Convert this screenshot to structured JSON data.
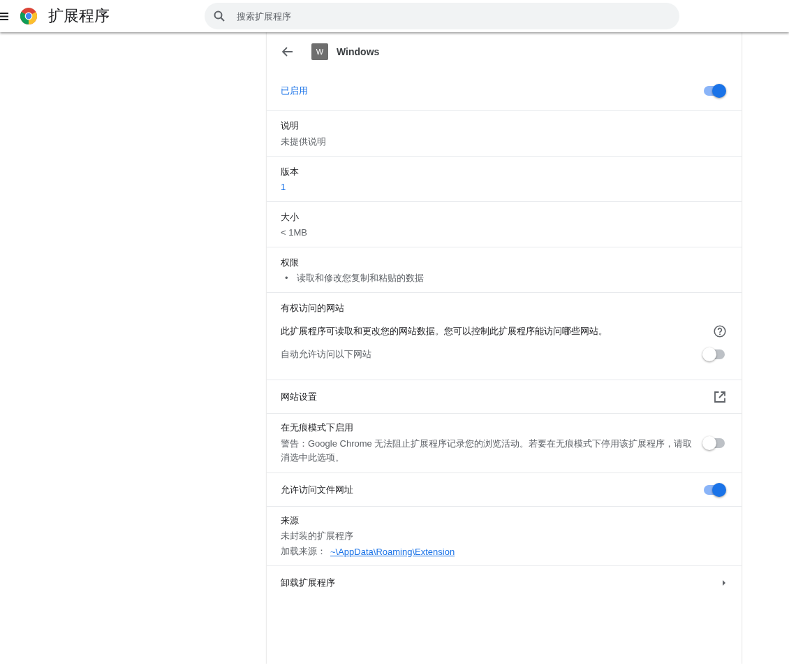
{
  "toolbar": {
    "title": "扩展程序",
    "search": {
      "placeholder": "搜索扩展程序"
    }
  },
  "extension": {
    "icon_letter": "W",
    "name": "Windows"
  },
  "rows": [
    {
      "kind": "toggle",
      "label": "已启用",
      "on": true
    },
    {
      "kind": "info",
      "title": "说明",
      "value": "未提供说明"
    },
    {
      "kind": "info-link",
      "title": "版本",
      "value": "1"
    },
    {
      "kind": "info",
      "title": "大小",
      "value": "< 1MB"
    },
    {
      "kind": "list",
      "title": "权限",
      "items": [
        {
          "bullet": "•",
          "text": "读取和修改您复制和粘贴的数据"
        }
      ]
    },
    {
      "kind": "site-access",
      "title": "有权访问的网站",
      "description": "此扩展程序可读取和更改您的网站数据。您可以控制此扩展程序能访问哪些网站。",
      "option": "自动允许访问以下网站",
      "on": false
    },
    {
      "kind": "external",
      "label": "网站设置"
    },
    {
      "kind": "toggle-desc",
      "title": "在无痕模式下启用",
      "description": "警告：Google Chrome 无法阻止扩展程序记录您的浏览活动。若要在无痕模式下停用该扩展程序，请取消选中此选项。",
      "on": false
    },
    {
      "kind": "plain-toggle",
      "label": "允许访问文件网址",
      "on": true
    },
    {
      "kind": "source",
      "title": "来源",
      "value": "未封装的扩展程序",
      "load_label": "加载来源：",
      "path": "~\\AppData\\Roaming\\Extension"
    },
    {
      "kind": "nav",
      "label": "卸载扩展程序"
    }
  ]
}
